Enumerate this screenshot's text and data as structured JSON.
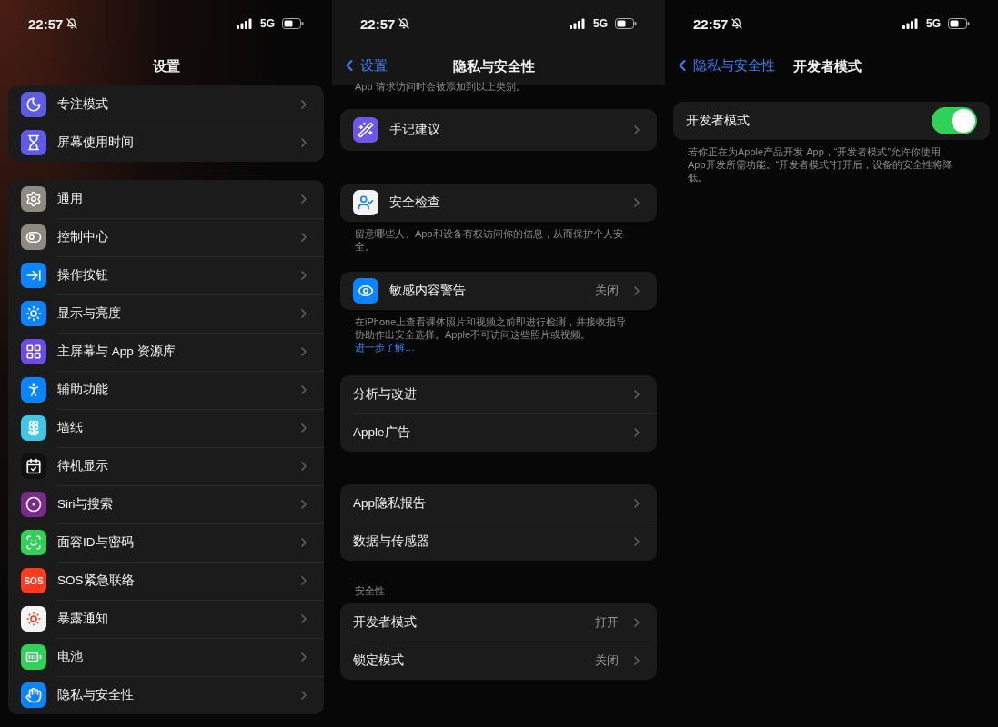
{
  "panes": [
    {
      "status": {
        "time": "22:57",
        "network": "5G"
      },
      "nav": {
        "title": "设置"
      },
      "groups": [
        {
          "rows": [
            {
              "kind": "link",
              "label": "专注模式",
              "color": "#5e5ce6"
            },
            {
              "kind": "link",
              "label": "屏幕使用时间",
              "color": "#5e5ce6"
            }
          ]
        },
        {
          "rows": [
            {
              "kind": "link",
              "label": "通用",
              "color": "#8e8a80"
            },
            {
              "kind": "link",
              "label": "控制中心",
              "color": "#8e8a80"
            },
            {
              "kind": "link",
              "label": "操作按钮",
              "color": "#0a84ff"
            },
            {
              "kind": "link",
              "label": "显示与亮度",
              "color": "#0a84ff"
            },
            {
              "kind": "link",
              "label": "主屏幕与 App 资源库",
              "color": "#6b4de6"
            },
            {
              "kind": "link",
              "label": "辅助功能",
              "color": "#0a84ff"
            },
            {
              "kind": "link",
              "label": "墙纸",
              "color": "#3ec8e6"
            },
            {
              "kind": "link",
              "label": "待机显示",
              "color": "#111111"
            },
            {
              "kind": "link",
              "label": "Siri与搜索",
              "color": "#7a2a8a"
            },
            {
              "kind": "link",
              "label": "面容ID与密码",
              "color": "#30d158"
            },
            {
              "kind": "link",
              "label": "SOS紧急联络",
              "color": "#ff3b1f",
              "icon_text": "SOS"
            },
            {
              "kind": "link",
              "label": "暴露通知",
              "color": "#f5f5f5"
            },
            {
              "kind": "link",
              "label": "电池",
              "color": "#30d158"
            },
            {
              "kind": "link",
              "label": "隐私与安全性",
              "color": "#0a84ff"
            }
          ]
        }
      ]
    },
    {
      "status": {
        "time": "22:57",
        "network": "5G"
      },
      "nav": {
        "back": "设置",
        "title": "隐私与安全性"
      },
      "top_note": "App 请求访问时会被添加到以上类别。",
      "groups": [
        {
          "rows": [
            {
              "kind": "link",
              "label": "手记建议",
              "color": "#6e56e8"
            }
          ]
        },
        {
          "rows": [
            {
              "kind": "link",
              "label": "安全检查",
              "color": "#f5f5f5"
            }
          ],
          "footer": "留意哪些人、App和设备有权访问你的信息，从而保护个人安全。"
        },
        {
          "rows": [
            {
              "kind": "link",
              "label": "敏感内容警告",
              "color": "#0a84ff",
              "value": "关闭"
            }
          ],
          "footer": "在iPhone上查看裸体照片和视频之前即进行检测，并接收指导协助作出安全选择。Apple不可访问这些照片或视频。",
          "footer_link": "进一步了解…"
        },
        {
          "rows": [
            {
              "kind": "link",
              "label": "分析与改进"
            },
            {
              "kind": "link",
              "label": "Apple广告"
            }
          ]
        },
        {
          "rows": [
            {
              "kind": "link",
              "label": "App隐私报告"
            },
            {
              "kind": "link",
              "label": "数据与传感器"
            }
          ]
        },
        {
          "header": "安全性",
          "rows": [
            {
              "kind": "link",
              "label": "开发者模式",
              "value": "打开"
            },
            {
              "kind": "link",
              "label": "锁定模式",
              "value": "关闭"
            }
          ]
        }
      ]
    },
    {
      "status": {
        "time": "22:57",
        "network": "5G"
      },
      "nav": {
        "back": "隐私与安全性",
        "title": "开发者模式"
      },
      "groups": [
        {
          "rows": [
            {
              "kind": "toggle",
              "label": "开发者模式",
              "on": true
            }
          ],
          "footer": "若你正在为Apple产品开发 App，“开发者模式”允许你使用 App开发所需功能。“开发者模式”打开后，设备的安全性将降低。"
        }
      ]
    }
  ]
}
